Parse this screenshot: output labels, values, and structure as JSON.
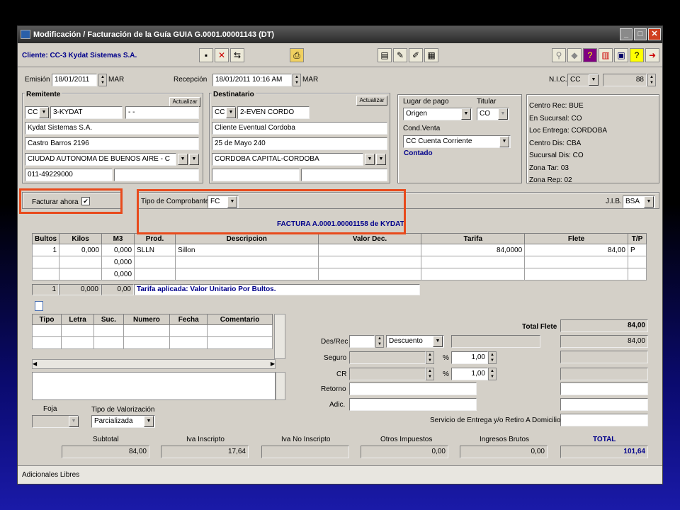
{
  "window": {
    "title": "Modificación / Facturación de la Guía GUIA G.0001.00001143  (DT)"
  },
  "client": {
    "label": "Cliente: CC-3 Kydat Sistemas S.A."
  },
  "header": {
    "emision_label": "Emisión",
    "emision_value": "18/01/2011",
    "emision_day": "MAR",
    "recepcion_label": "Recepción",
    "recepcion_value": "18/01/2011 10:16 AM",
    "recepcion_day": "MAR",
    "nic_label": "N.I.C.",
    "nic_type": "CC",
    "nic_value": "88"
  },
  "remitente": {
    "title": "Remitente",
    "actualizar": "Actualizar",
    "doc_type": "CC",
    "code": "3-KYDAT",
    "extra": " -     -",
    "name": "Kydat Sistemas S.A.",
    "address": "Castro Barros 2196",
    "city": "CIUDAD AUTONOMA DE BUENOS AIRE - C",
    "phone": "011-49229000"
  },
  "destinatario": {
    "title": "Destinatario",
    "actualizar": "Actualizar",
    "doc_type": "CC",
    "code": "2-EVEN CORDO",
    "name": "Cliente Eventual Cordoba",
    "address": "25 de Mayo 240",
    "city": "CORDOBA CAPITAL-CORDOBA"
  },
  "pago": {
    "lugar_label": "Lugar de pago",
    "lugar_value": "Origen",
    "titular_label": "Titular",
    "titular_value": "CO",
    "cond_label": "Cond.Venta",
    "cond_value": "CC Cuenta Corriente",
    "contado": "Contado"
  },
  "centros": [
    "Centro Rec: BUE",
    "En Sucursal: CO",
    "Loc Entrega: CORDOBA",
    "Centro Dis: CBA",
    "Sucursal Dis: CO",
    "Zona Tar: 03",
    "Zona Rep: 02"
  ],
  "facturar": {
    "label": "Facturar ahora",
    "check": "✔"
  },
  "comprobante": {
    "label": "Tipo de Comprobante",
    "value": "FC",
    "jib_label": "J.I.B.",
    "jib_value": "BSA"
  },
  "factura_title": "FACTURA A.0001.00001158 de KYDAT",
  "items": {
    "headers": [
      "Bultos",
      "Kilos",
      "M3",
      "Prod.",
      "Descripcion",
      "Valor Dec.",
      "Tarifa",
      "Flete",
      "T/P"
    ],
    "rows": [
      [
        "1",
        "0,000",
        "0,000",
        "SLLN",
        "Sillon",
        "",
        "84,0000",
        "84,00",
        "P"
      ],
      [
        "",
        "",
        "0,000",
        "",
        "",
        "",
        "",
        "",
        ""
      ],
      [
        "",
        "",
        "0,000",
        "",
        "",
        "",
        "",
        "",
        ""
      ]
    ],
    "totals": [
      "1",
      "0,000",
      "0,00"
    ],
    "tarifa_note": "Tarifa aplicada: Valor Unitario Por Bultos."
  },
  "docs": {
    "headers": [
      "Tipo",
      "Letra",
      "Suc.",
      "Numero",
      "Fecha",
      "Comentario"
    ]
  },
  "charges": {
    "total_flete_label": "Total Flete",
    "total_flete": "84,00",
    "flete2": "84,00",
    "desrec_label": "Des/Rec",
    "desrec_value": "Descuento",
    "seguro_label": "Seguro",
    "seguro_pct": "1,00",
    "cr_label": "CR",
    "cr_pct": "1,00",
    "pct_symbol": "%",
    "retorno_label": "Retorno",
    "adic_label": "Adic.",
    "servicio_label": "Servicio de Entrega y/o Retiro A Domicilio"
  },
  "valorizacion": {
    "foja_label": "Foja",
    "tipo_label": "Tipo de Valorización",
    "tipo_value": "Parcializada"
  },
  "totales": {
    "subtotal_label": "Subtotal",
    "subtotal": "84,00",
    "iva_insc_label": "Iva Inscripto",
    "iva_insc": "17,64",
    "iva_no_label": "Iva No Inscripto",
    "iva_no": "",
    "otros_label": "Otros Impuestos",
    "otros": "0,00",
    "ingresos_label": "Ingresos Brutos",
    "ingresos": "0,00",
    "total_label": "TOTAL",
    "total": "101,64"
  },
  "footer": {
    "adicionales": "Adicionales Libres"
  },
  "icons": [
    "save-icon",
    "delete-icon",
    "link-icon",
    "print-icon",
    "stamp-icon",
    "tools-icon",
    "edit-icon",
    "form-icon",
    "search-icon",
    "tag-icon",
    "help-icon",
    "grid-icon",
    "calc-icon",
    "question-icon",
    "exit-icon"
  ]
}
